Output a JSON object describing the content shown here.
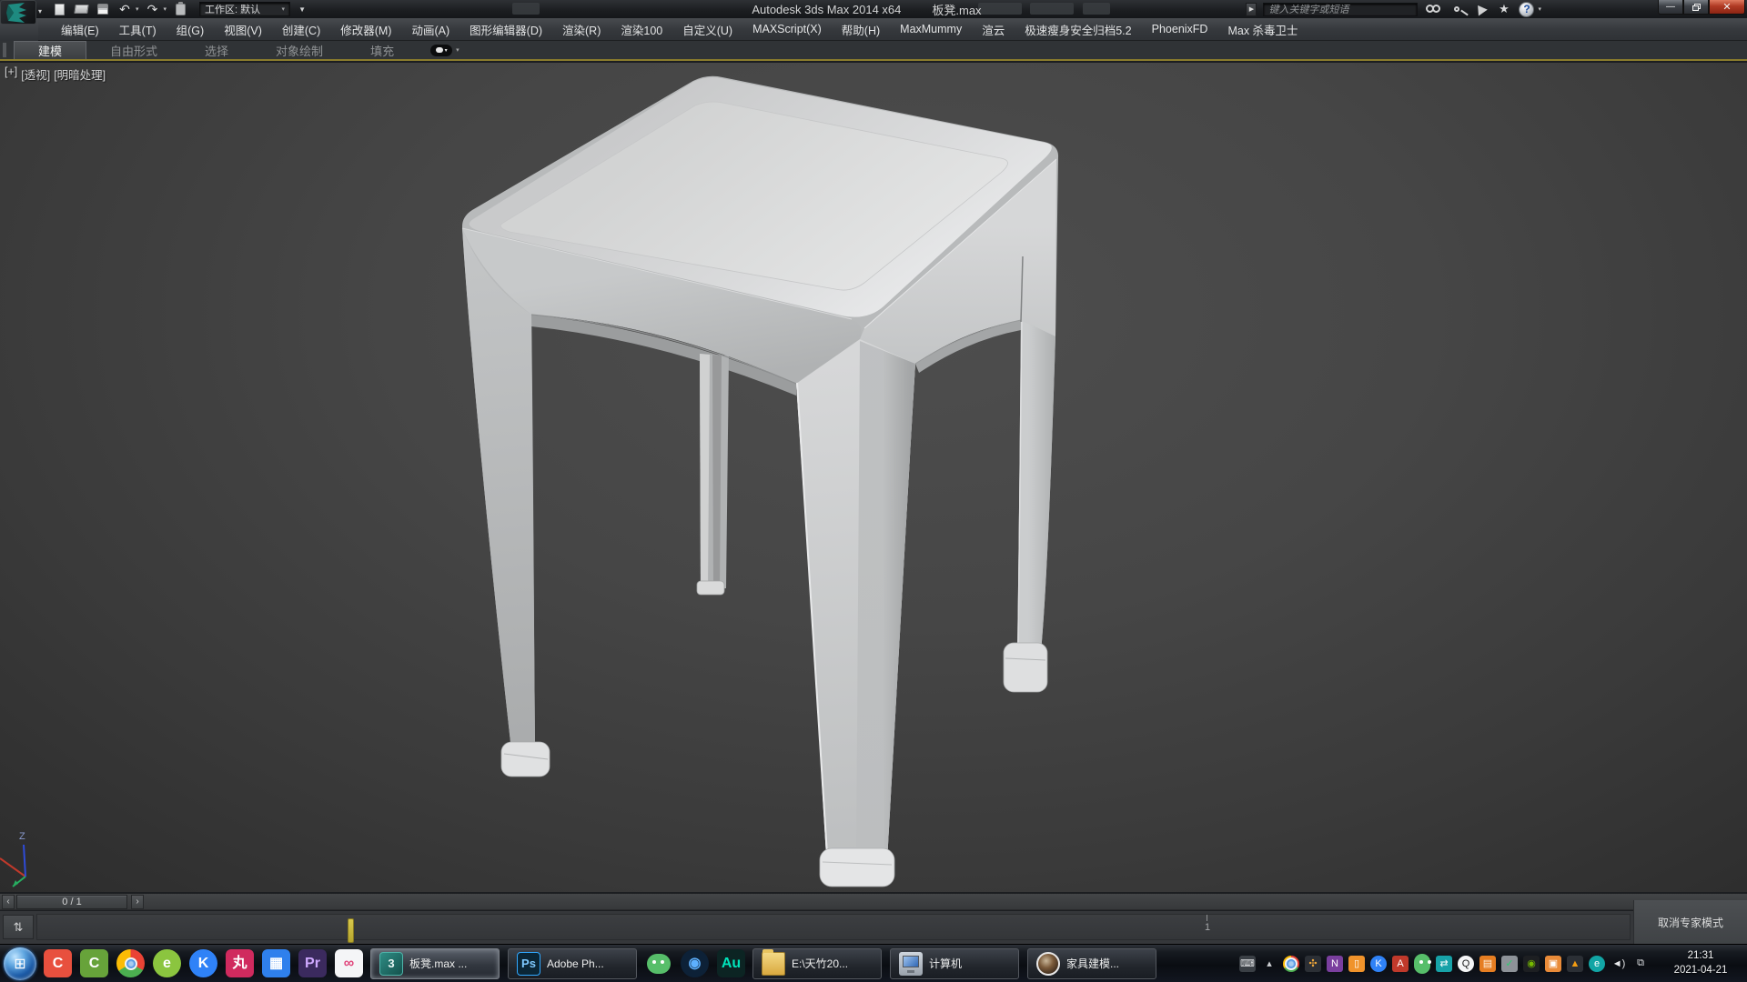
{
  "titlebar": {
    "title_app": "Autodesk 3ds Max  2014 x64",
    "title_file": "板凳.max",
    "workspace": "工作区: 默认",
    "search_placeholder": "键入关键字或短语"
  },
  "menubar": {
    "items": [
      "编辑(E)",
      "工具(T)",
      "组(G)",
      "视图(V)",
      "创建(C)",
      "修改器(M)",
      "动画(A)",
      "图形编辑器(D)",
      "渲染(R)",
      "渲染100",
      "自定义(U)",
      "MAXScript(X)",
      "帮助(H)",
      "MaxMummy",
      "渲云",
      "极速瘦身安全归档5.2",
      "PhoenixFD",
      "Max 杀毒卫士"
    ]
  },
  "ribbon": {
    "tabs": [
      {
        "name": "tab-modeling",
        "label": "建模",
        "active": true
      },
      {
        "name": "tab-freeform",
        "label": "自由形式",
        "active": false
      },
      {
        "name": "tab-selection",
        "label": "选择",
        "active": false
      },
      {
        "name": "tab-object-paint",
        "label": "对象绘制",
        "active": false
      },
      {
        "name": "tab-populate",
        "label": "填充",
        "active": false
      }
    ]
  },
  "viewport": {
    "labels": [
      "[+]",
      "[透视]",
      "[明暗处理]"
    ],
    "axis_z_label": "Z"
  },
  "timeline": {
    "prev": "‹",
    "frame_indicator": "0 / 1",
    "next": "›",
    "tick_label": "1"
  },
  "statusbar": {
    "expert_button": "取消专家模式"
  },
  "taskbar": {
    "start_glyph": "⊞",
    "apps_left": [
      {
        "name": "app-camtasia",
        "glyph": "C",
        "bg": "#e8503e",
        "color": "#ffffff"
      },
      {
        "name": "app-camtasia-recorder",
        "glyph": "C",
        "bg": "#67a33a",
        "color": "#ffffff"
      },
      {
        "name": "app-chrome",
        "glyph": "",
        "cls": "c-chrome"
      },
      {
        "name": "app-browser-360",
        "glyph": "e",
        "bg": "#8bc53f",
        "color": "#ffffff",
        "cls": "c-circle"
      },
      {
        "name": "app-kuaijian",
        "glyph": "K",
        "bg": "#2f82f7",
        "color": "#ffffff",
        "cls": "c-circle"
      },
      {
        "name": "app-wan",
        "glyph": "丸",
        "bg": "#d02a5e",
        "color": "#ffffff"
      },
      {
        "name": "app-video-editor",
        "glyph": "▦",
        "bg": "#2f80ed",
        "color": "#ffffff"
      },
      {
        "name": "app-premiere",
        "glyph": "Pr",
        "bg": "#3b2a5e",
        "color": "#cfa9ff"
      },
      {
        "name": "app-rings",
        "glyph": "∞",
        "bg": "#f4f5f7",
        "color": "#e0457b"
      }
    ],
    "buttons_mid": [
      {
        "name": "task-3dsmax",
        "cls": "m-max",
        "glyph": "3",
        "label": "板凳.max ...",
        "active": true
      },
      {
        "name": "task-photoshop",
        "cls": "m-ps",
        "glyph": "Ps",
        "label": "Adobe Ph..."
      }
    ],
    "apps_mid": [
      {
        "name": "app-wechat",
        "glyph": "",
        "cls": "c-wechat"
      },
      {
        "name": "app-aperture",
        "glyph": "◉",
        "bg": "#0d2137",
        "color": "#5db0ff",
        "cls": "c-circle"
      },
      {
        "name": "app-audition",
        "glyph": "Au",
        "bg": "#0c2423",
        "color": "#00e4bb"
      }
    ],
    "buttons_right": [
      {
        "name": "task-folder-window",
        "cls": "m-folder",
        "glyph": "",
        "label": "E:\\天竹20..."
      },
      {
        "name": "task-computer",
        "cls": "m-pc",
        "glyph": "",
        "label": "计算机"
      },
      {
        "name": "task-furniture-modeling",
        "cls": "m-furn",
        "glyph": "",
        "label": "家具建模..."
      }
    ],
    "tray": [
      {
        "name": "tray-input-keyboard",
        "glyph": "⌨",
        "bg": "#3a3f45",
        "color": "#e0e2e4"
      },
      {
        "name": "tray-show-hidden",
        "glyph": "▴",
        "bg": "transparent",
        "color": "#cfd2d5"
      },
      {
        "name": "tray-chrome",
        "glyph": "",
        "cls": "c-chrome"
      },
      {
        "name": "tray-pinwheel",
        "glyph": "✣",
        "bg": "#2b2f35",
        "color": "#f2a93b"
      },
      {
        "name": "tray-memory-clean",
        "glyph": "N",
        "bg": "#7a3f9e",
        "color": "#ffffff"
      },
      {
        "name": "tray-orange-util",
        "glyph": "▯",
        "bg": "#f0932b",
        "color": "#ffffff"
      },
      {
        "name": "tray-k-service",
        "glyph": "K",
        "bg": "#2f82f7",
        "color": "#ffffff",
        "cls": "t-circle"
      },
      {
        "name": "tray-pdf",
        "glyph": "A",
        "bg": "#c0392b",
        "color": "#ffffff"
      },
      {
        "name": "tray-wechat",
        "glyph": "",
        "cls": "c-wechat"
      },
      {
        "name": "tray-transfer",
        "glyph": "⇄",
        "bg": "#17a2a8",
        "color": "#ffffff"
      },
      {
        "name": "tray-qq",
        "glyph": "Q",
        "bg": "#f5f6f7",
        "color": "#1a1a1a",
        "cls": "t-circle"
      },
      {
        "name": "tray-window-util",
        "glyph": "▤",
        "bg": "#e67e22",
        "color": "#fff3e0"
      },
      {
        "name": "tray-usb",
        "glyph": "✓",
        "bg": "#8d9298",
        "color": "#2ecc71"
      },
      {
        "name": "tray-nvidia",
        "glyph": "◉",
        "bg": "#1d1f22",
        "color": "#76b900"
      },
      {
        "name": "tray-screenshot",
        "glyph": "▣",
        "bg": "#e98b39",
        "color": "#ffffff"
      },
      {
        "name": "tray-firewall",
        "glyph": "▲",
        "bg": "#2b2f35",
        "color": "#f39c12"
      },
      {
        "name": "tray-eset",
        "glyph": "e",
        "bg": "#12a5a5",
        "color": "#ffffff",
        "cls": "t-circle"
      },
      {
        "name": "tray-volume",
        "glyph": "◄)",
        "bg": "transparent",
        "color": "#e8eaec"
      },
      {
        "name": "tray-network",
        "glyph": "⧉",
        "bg": "transparent",
        "color": "#dfe2e5"
      }
    ],
    "clock": {
      "time": "21:31",
      "date": "2021-04-21"
    }
  },
  "colors": {
    "accent_olive": "#8a7c2c",
    "titlebar_bg": "#1c1e21",
    "menubar_bg": "#3a3d41",
    "viewport_bg_top": "#4e4e4e",
    "viewport_bg_bottom": "#2b2b2b",
    "stool_light": "#e4e5e6",
    "stool_mid": "#b8babb",
    "time_marker_yellow": "#c9b83a",
    "close_button_red": "#b03a24",
    "axis_x_red": "#c0392b",
    "axis_y_green": "#27ae60",
    "axis_z_blue": "#2e4bd8"
  }
}
